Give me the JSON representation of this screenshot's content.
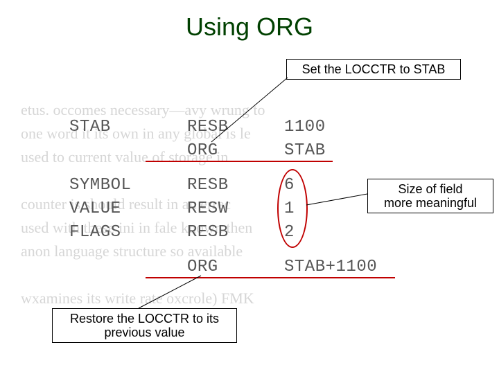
{
  "title": "Using ORG",
  "callouts": {
    "set": "Set the LOCCTR to STAB",
    "size_l1": "Size of field",
    "size_l2": "more meaningful",
    "restore_l1": "Restore the LOCCTR to its",
    "restore_l2": "previous value"
  },
  "code": {
    "r1c1": "STAB",
    "r1c2": "RESB",
    "r1c3": "1100",
    "r2c1": "",
    "r2c2": "ORG",
    "r2c3": "STAB",
    "r3c1": "SYMBOL",
    "r3c2": "RESB",
    "r3c3": "6",
    "r4c1": "VALUE",
    "r4c2": "RESW",
    "r4c3": "1",
    "r5c1": "FLAGS",
    "r5c2": "RESB",
    "r5c3": "2",
    "r6c1": "",
    "r6c2": "ORG",
    "r6c3": "STAB+1100"
  },
  "bg": {
    "l1": "etus. occomes necessary—avy wrung to",
    "l2": "one word it its own in any global is le",
    "l3": "used to current value of storage in",
    "l4": "counter is should result in an errec",
    "l5": "used with these ini in fale known then",
    "l6": "anon language structure so available",
    "l7": "wxamines its write rate oxcrole) FMK"
  }
}
